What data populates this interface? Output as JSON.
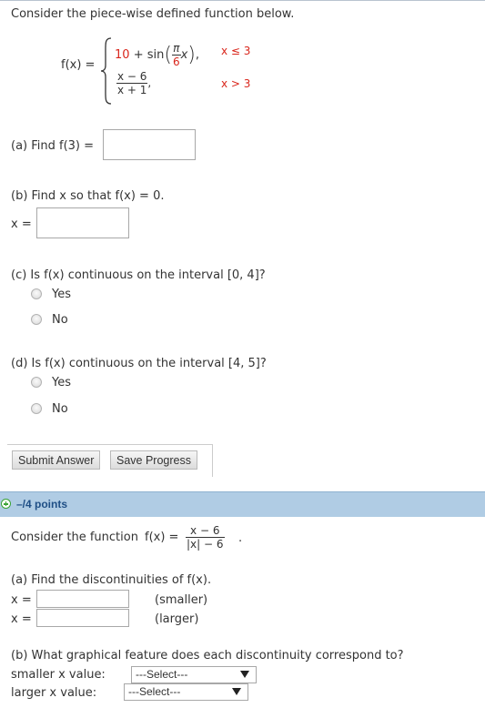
{
  "q1": {
    "intro": "Consider the piece-wise defined function below.",
    "fx_label": "f(x) =",
    "piece1": {
      "const": "10",
      "plus_sin": "+ sin",
      "pi": "π",
      "six": "6",
      "x": "x",
      "comma": ",",
      "cond": "x ≤ 3"
    },
    "piece2": {
      "num": "x − 6",
      "den": "x + 1",
      "comma": ",",
      "cond": "x > 3"
    },
    "part_a": {
      "label": "(a) Find f(3) =",
      "value": ""
    },
    "part_b": {
      "label": "(b) Find x so that f(x) = 0.",
      "x_label": "x =",
      "value": ""
    },
    "part_c": {
      "label": "(c) Is f(x) continuous on the interval [0, 4]?",
      "options": [
        "Yes",
        "No"
      ]
    },
    "part_d": {
      "label": "(d) Is f(x) continuous on the interval [4, 5]?",
      "options": [
        "Yes",
        "No"
      ]
    },
    "buttons": {
      "submit": "Submit Answer",
      "save": "Save Progress"
    }
  },
  "q2": {
    "header": {
      "icon": "plus-icon",
      "points": "–/4 points"
    },
    "intro": "Consider the function",
    "fx": "f(x) =",
    "num": "x − 6",
    "den": "|x| − 6",
    "period": ".",
    "part_a": {
      "label": "(a) Find the discontinuities of f(x).",
      "x1_label": "x =",
      "x1_hint": "(smaller)",
      "x2_label": "x =",
      "x2_hint": "(larger)"
    },
    "part_b": {
      "label": "(b) What graphical feature does each discontinuity correspond to?",
      "smaller_label": "smaller x value:",
      "smaller_select": "---Select---",
      "larger_label": "larger x value:",
      "larger_select": "---Select---"
    }
  },
  "colors": {
    "red": "#d9261c",
    "header": "#b0cce4",
    "header_text": "#1f4f86",
    "plus": "#3aa335"
  }
}
